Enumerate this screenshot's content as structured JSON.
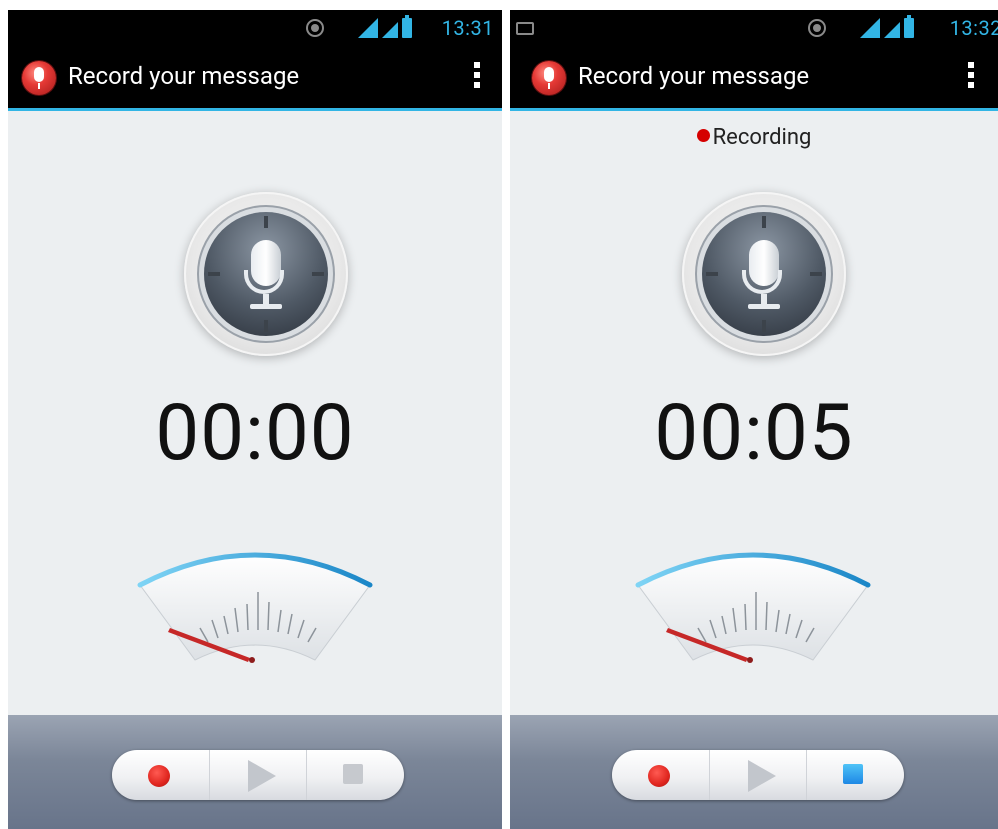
{
  "screens": [
    {
      "status_time": "13:31",
      "title": "Record your message",
      "recording_label": "",
      "timer": "00:00",
      "stop_active": false
    },
    {
      "status_time": "13:32",
      "title": "Record your message",
      "recording_label": "Recording",
      "timer": "00:05",
      "stop_active": true
    }
  ],
  "colors": {
    "accent": "#32b5e5",
    "record_red": "#e0261f",
    "stop_active_blue": "#1e88e5"
  },
  "icons": {
    "app": "microphone-app-icon",
    "overflow": "overflow-menu-icon",
    "mic": "microphone-icon",
    "record": "record-icon",
    "play": "play-icon",
    "stop": "stop-icon",
    "meter": "vu-meter-icon"
  }
}
